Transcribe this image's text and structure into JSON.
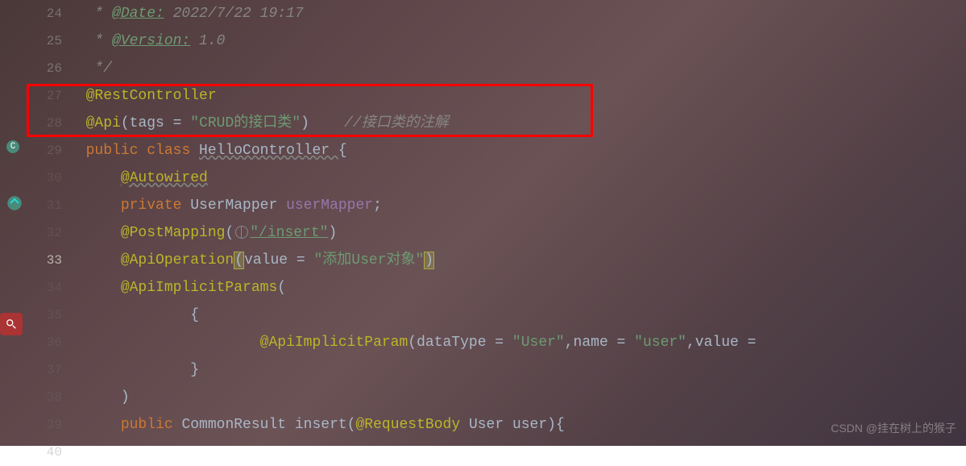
{
  "gutter": {
    "lines": [
      "24",
      "25",
      "26",
      "27",
      "28",
      "29",
      "30",
      "31",
      "32",
      "33",
      "34",
      "35",
      "36",
      "37",
      "38",
      "39",
      "40"
    ]
  },
  "code": {
    "l24_pre": " * ",
    "l24_tag": "@Date:",
    "l24_val": " 2022/7/22 19:17",
    "l25_pre": " * ",
    "l25_tag": "@Version:",
    "l25_val": " 1.0",
    "l26": " */",
    "l27_anno": "@RestController",
    "l28_anno": "@Api",
    "l28_paren": "(",
    "l28_attr": "tags = ",
    "l28_str": "\"CRUD的接口类\"",
    "l28_close": ")",
    "l28_comment": "    //接口类的注解",
    "l29_pub": "public ",
    "l29_class": "class ",
    "l29_name": "HelloController ",
    "l29_brace": "{",
    "l30_anno": "@Autowired",
    "l31_priv": "private ",
    "l31_type": "UserMapper ",
    "l31_field": "userMapper",
    "l31_semi": ";",
    "l32_anno": "@PostMapping",
    "l32_open": "(",
    "l32_str": "\"/insert\"",
    "l32_close": ")",
    "l33_anno": "@ApiOperation",
    "l33_open": "(",
    "l33_attr": "value = ",
    "l33_str": "\"添加User对象\"",
    "l33_close": ")",
    "l34_anno": "@ApiImplicitParams",
    "l34_open": "(",
    "l35_brace": "{",
    "l36_anno": "@ApiImplicitParam",
    "l36_open": "(",
    "l36_dt": "dataType = ",
    "l36_dtv": "\"User\"",
    "l36_c1": ",",
    "l36_name": "name = ",
    "l36_nv": "\"user\"",
    "l36_c2": ",",
    "l36_val": "value = ",
    "l37_brace": "}",
    "l38_paren": ")",
    "l39_pub": "public ",
    "l39_type": "CommonResult ",
    "l39_method": "insert",
    "l39_open": "(",
    "l39_anno": "@RequestBody ",
    "l39_ptype": "User ",
    "l39_pname": "user",
    "l39_close": "){"
  },
  "watermark": "CSDN @挂在树上的猴子"
}
